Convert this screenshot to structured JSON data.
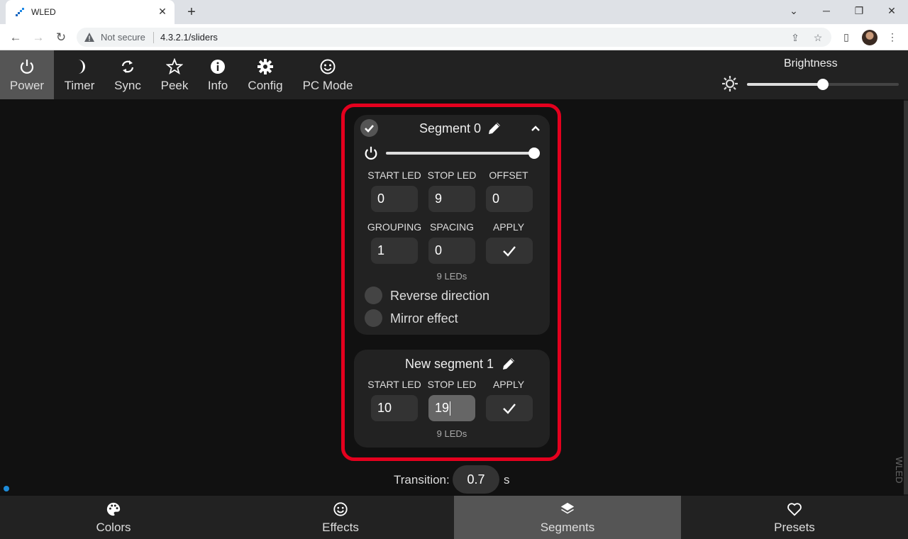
{
  "browser": {
    "tab_title": "WLED",
    "new_tab": "+",
    "security_text": "Not secure",
    "url": "4.3.2.1/sliders"
  },
  "topbar": {
    "buttons": [
      {
        "label": "Power",
        "icon": "power-icon"
      },
      {
        "label": "Timer",
        "icon": "moon-icon"
      },
      {
        "label": "Sync",
        "icon": "sync-icon"
      },
      {
        "label": "Peek",
        "icon": "star-icon"
      },
      {
        "label": "Info",
        "icon": "info-icon"
      },
      {
        "label": "Config",
        "icon": "gear-icon"
      },
      {
        "label": "PC Mode",
        "icon": "smiley-icon"
      }
    ],
    "active": "Power",
    "brightness_label": "Brightness",
    "brightness_level": 0.5
  },
  "segment0": {
    "title": "Segment 0",
    "brightness_level": 1.0,
    "labels": {
      "start": "START LED",
      "stop": "STOP LED",
      "offset": "OFFSET",
      "grouping": "GROUPING",
      "spacing": "SPACING",
      "apply": "APPLY"
    },
    "start_led": "0",
    "stop_led": "9",
    "offset": "0",
    "grouping": "1",
    "spacing": "0",
    "led_count": "9 LEDs",
    "reverse_label": "Reverse direction",
    "mirror_label": "Mirror effect"
  },
  "segment_new": {
    "title": "New segment 1",
    "labels": {
      "start": "START LED",
      "stop": "STOP LED",
      "apply": "APPLY"
    },
    "start_led": "10",
    "stop_led": "19",
    "led_count": "9 LEDs"
  },
  "transition": {
    "label": "Transition:",
    "value": "0.7",
    "unit": "s"
  },
  "side_label": "WLED",
  "bottombar": {
    "buttons": [
      {
        "label": "Colors",
        "icon": "palette-icon"
      },
      {
        "label": "Effects",
        "icon": "smiley-icon"
      },
      {
        "label": "Segments",
        "icon": "layers-icon"
      },
      {
        "label": "Presets",
        "icon": "heart-icon"
      }
    ],
    "active": "Segments"
  },
  "colors": {
    "highlight": "#e4001e",
    "bg": "#111111",
    "panel": "#222222",
    "active": "#555555"
  }
}
